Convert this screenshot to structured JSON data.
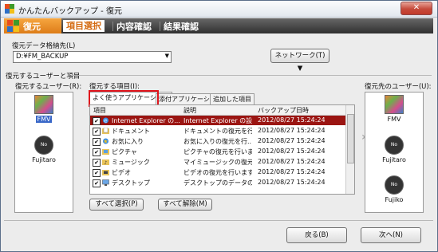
{
  "window": {
    "title": "かんたんバックアップ - 復元"
  },
  "header": {
    "brand": "復元",
    "steps": [
      "項目選択",
      "内容確認",
      "結果確認"
    ]
  },
  "destination": {
    "label": "復元データ格納先(L)",
    "value": "D:¥FM_BACKUP",
    "network_button": "ネットワーク(T) ▼"
  },
  "section_label": "復元するユーザーと項目",
  "source_users": {
    "label": "復元するユーザー(R):",
    "users": [
      "FMV",
      "Fujitaro"
    ]
  },
  "items": {
    "label": "復元する項目(I):",
    "tabs": [
      "よく使うアプリケーション",
      "添付アプリケーション",
      "追加した項目"
    ],
    "columns": [
      "項目",
      "説明",
      "バックアップ日時"
    ],
    "rows": [
      {
        "name": "Internet Explorer の...",
        "desc": "Internet Explorer の設...",
        "date": "2012/08/27  15:24:24",
        "selected": true,
        "icon": "ie-icon"
      },
      {
        "name": "ドキュメント",
        "desc": "ドキュメントの復元を行...",
        "date": "2012/08/27  15:24:24",
        "icon": "documents-icon"
      },
      {
        "name": "お気に入り",
        "desc": "お気に入りの復元を行...",
        "date": "2012/08/27  15:24:24",
        "icon": "favorites-icon"
      },
      {
        "name": "ピクチャ",
        "desc": "ピクチャの復元を行いま...",
        "date": "2012/08/27  15:24:24",
        "icon": "pictures-icon"
      },
      {
        "name": "ミュージック",
        "desc": "マイミュージックの復元...",
        "date": "2012/08/27  15:24:24",
        "icon": "music-icon"
      },
      {
        "name": "ビデオ",
        "desc": "ビデオの復元を行います。",
        "date": "2012/08/27  15:24:24",
        "icon": "video-icon"
      },
      {
        "name": "デスクトップ",
        "desc": "デスクトップのデータの復...",
        "date": "2012/08/27  15:24:24",
        "icon": "desktop-icon"
      }
    ],
    "select_all": "すべて選択(P)",
    "deselect_all": "すべて解除(M)"
  },
  "dest_users": {
    "label": "復元先のユーザー(U):",
    "users": [
      "FMV",
      "Fujitaro",
      "Fujiko"
    ]
  },
  "footer": {
    "back": "戻る(B)",
    "next": "次へ(N)"
  },
  "colors": {
    "accent": "#e0141c",
    "selected_row": "#9b1512",
    "header_orange": "#dd7c18"
  }
}
